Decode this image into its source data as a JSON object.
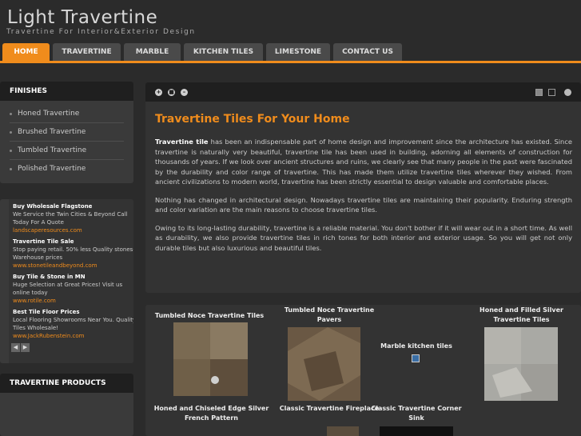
{
  "site": {
    "title": "Light Travertine",
    "tagline": "Travertine For Interior&Exterior Design"
  },
  "nav": {
    "items": [
      {
        "label": "HOME",
        "active": true
      },
      {
        "label": "TRAVERTINE"
      },
      {
        "label": "MARBLE"
      },
      {
        "label": "KITCHEN TILES"
      },
      {
        "label": "LIMESTONE"
      },
      {
        "label": "CONTACT US"
      }
    ]
  },
  "finishes": {
    "title": "FINISHES",
    "items": [
      "Honed Travertine",
      "Brushed Travertine",
      "Tumbled Travertine",
      "Polished Travertine"
    ]
  },
  "ads": [
    {
      "title": "Buy Wholesale Flagstone",
      "text": "We Service the Twin Cities & Beyond Call Today For A Quote",
      "url": "landscaperesources.com"
    },
    {
      "title": "Travertine Tile Sale",
      "text": "Stop paying retail. 50% less Quality stones-Warehouse prices",
      "url": "www.stonetileandbeyond.com"
    },
    {
      "title": "Buy Tile & Stone in MN",
      "text": "Huge Selection at Great Prices! Visit us online today",
      "url": "www.rotile.com"
    },
    {
      "title": "Best Tile Floor Prices",
      "text": "Local Flooring Showrooms Near You. Quality Tiles Wholesale!",
      "url": "www.JackRubenstein.com"
    }
  ],
  "ad_nav": {
    "prev": "◀",
    "next": "▶"
  },
  "products": {
    "title": "TRAVERTINE PRODUCTS"
  },
  "main": {
    "toolbar": {
      "plus": "+",
      "square": "■",
      "minus": "–"
    },
    "title": "Travertine Tiles For Your Home",
    "p1_bold": "Travertine tile",
    "p1_rest": " has been an indispensable part of home design and improvement since the architecture has existed. Since travertine is naturally very beautiful, travertine tile has been used in building, adorning all elements of construction for thousands of years. If we look over ancient structures and ruins, we clearly see that many people in the past were fascinated by the durability and color range of travertine. This has made them utilize travertine tiles wherever they wished. From ancient civilizations to modern world, travertine has been strictly essential to design valuable and comfortable places.",
    "p2": "Nothing has changed in architectural design. Nowadays travertine tiles are maintaining their popularity. Enduring strength and color variation are the main reasons to choose travertine tiles.",
    "p3": "Owing to its long-lasting durability, travertine is a reliable material. You don't bother if it will wear out in a short time. As well as durability, we also provide travertine tiles in rich tones for both interior and exterior usage. So you will get not only durable tiles but also luxurious and beautiful tiles."
  },
  "gallery": {
    "items": [
      {
        "caption": "Tumbled Noce Travertine Tiles"
      },
      {
        "caption": "Tumbled Noce Travertine Pavers"
      },
      {
        "caption": "Marble kitchen tiles"
      },
      {
        "caption": "Honed and Filled Silver Travertine Tiles"
      },
      {
        "caption": "Honed and Chiseled Edge Silver French Pattern"
      },
      {
        "caption": "Classic Travertine Fireplace"
      },
      {
        "caption": "Classic Travertine Corner Sink"
      }
    ]
  },
  "colors": {
    "accent": "#f08c1c",
    "panel": "#3a3a3a",
    "header": "#1f1f1f"
  }
}
